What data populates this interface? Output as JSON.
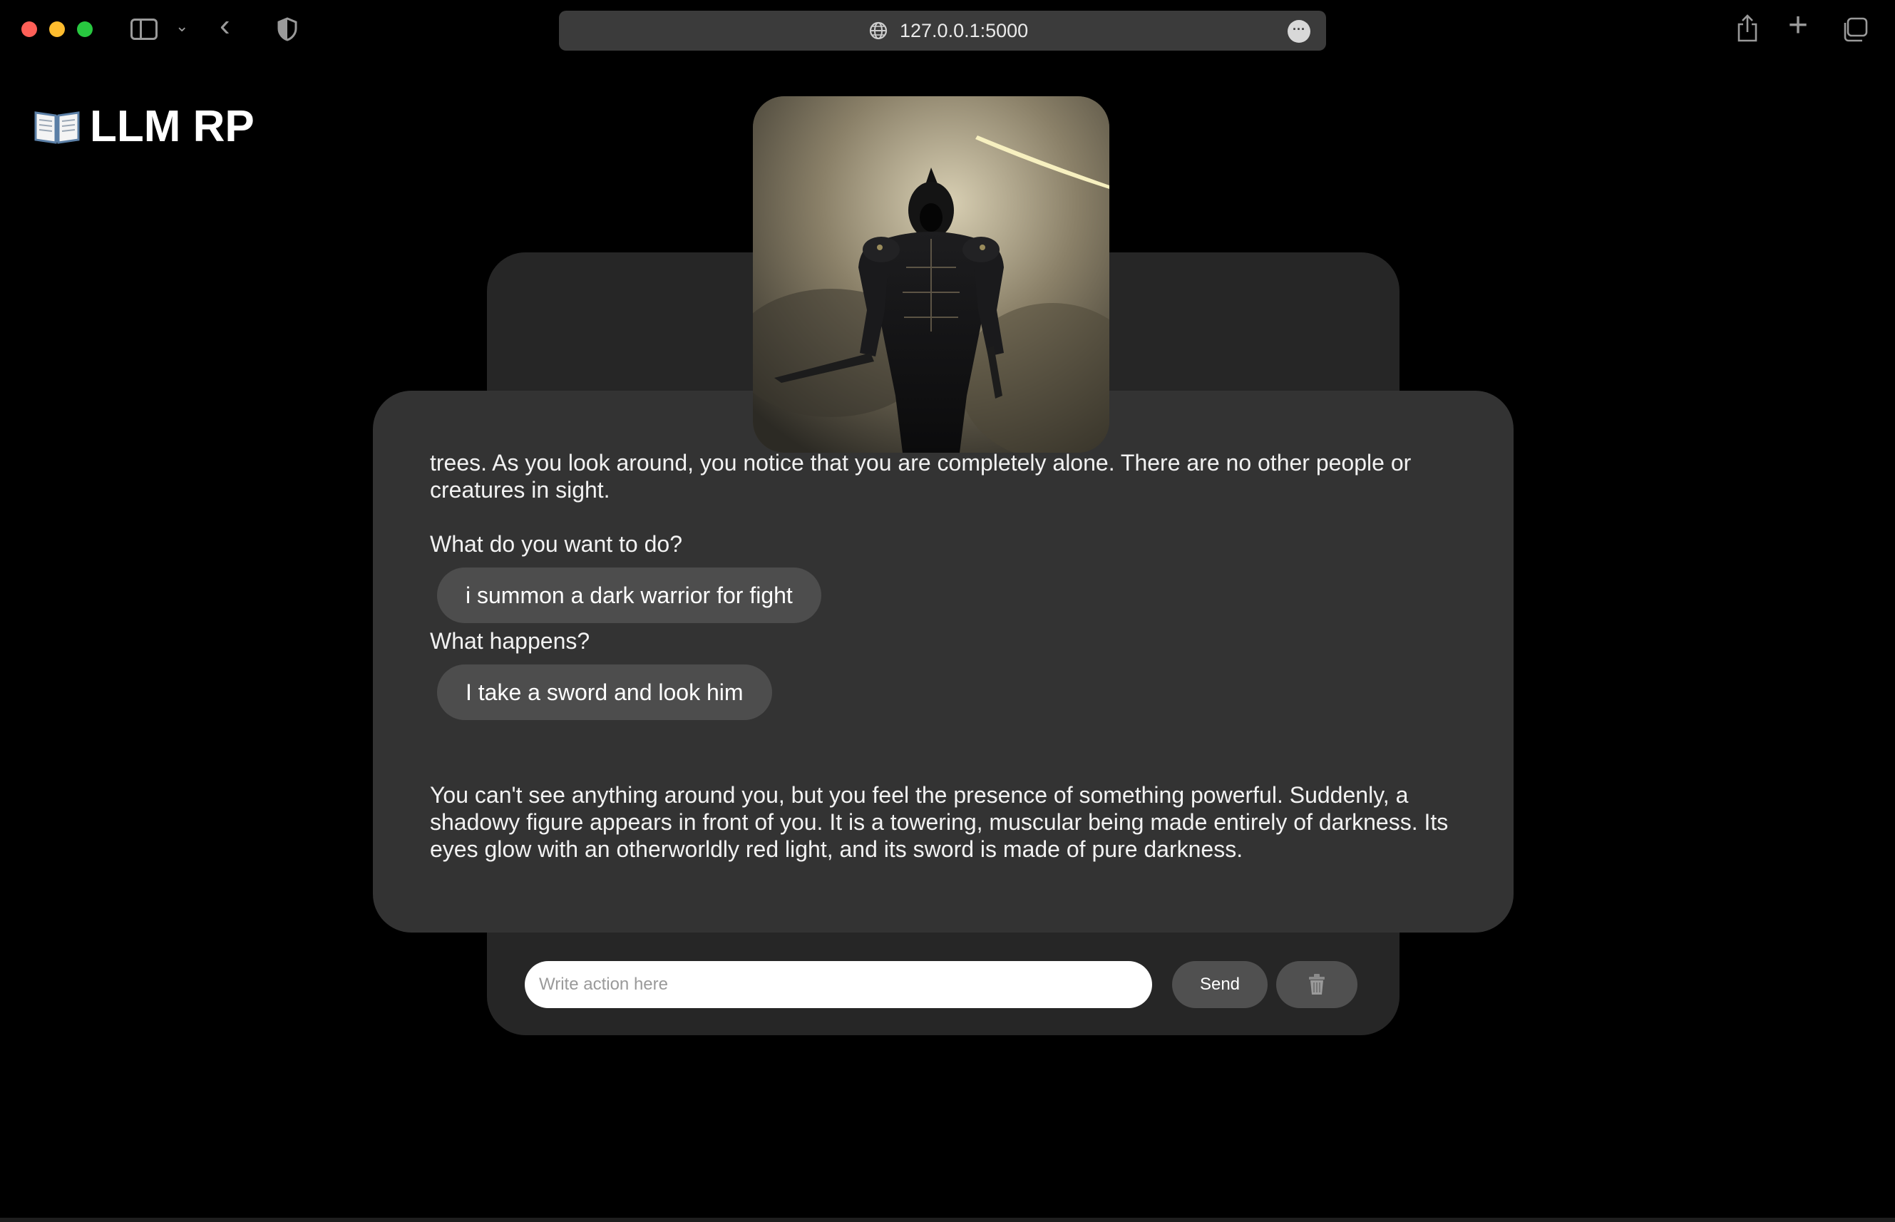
{
  "browser": {
    "url": "127.0.0.1:5000"
  },
  "app": {
    "title": "LLM RP",
    "title_icon": "open-book-icon"
  },
  "story": {
    "image": "dark-warrior-portrait",
    "messages": [
      {
        "role": "narrator",
        "text": "trees. As you look around, you notice that you are completely alone. There are no other people or creatures in sight."
      },
      {
        "role": "narrator",
        "text": "What do you want to do?"
      },
      {
        "role": "user",
        "text": "i summon a dark warrior for fight"
      },
      {
        "role": "narrator",
        "text": "What happens?"
      },
      {
        "role": "user",
        "text": "I take a sword and look him"
      },
      {
        "role": "narrator",
        "text": "You can't see anything around you, but you feel the presence of something powerful. Suddenly, a shadowy figure appears in front of you. It is a towering, muscular being made entirely of darkness. Its eyes glow with an otherworldly red light, and its sword is made of pure darkness."
      }
    ]
  },
  "composer": {
    "placeholder": "Write action here",
    "value": "",
    "send_label": "Send",
    "clear_icon": "trash-icon"
  },
  "colors": {
    "background": "#000000",
    "card": "#333333",
    "back_card": "#262626",
    "chip": "#4d4d4d",
    "button": "#505050"
  }
}
